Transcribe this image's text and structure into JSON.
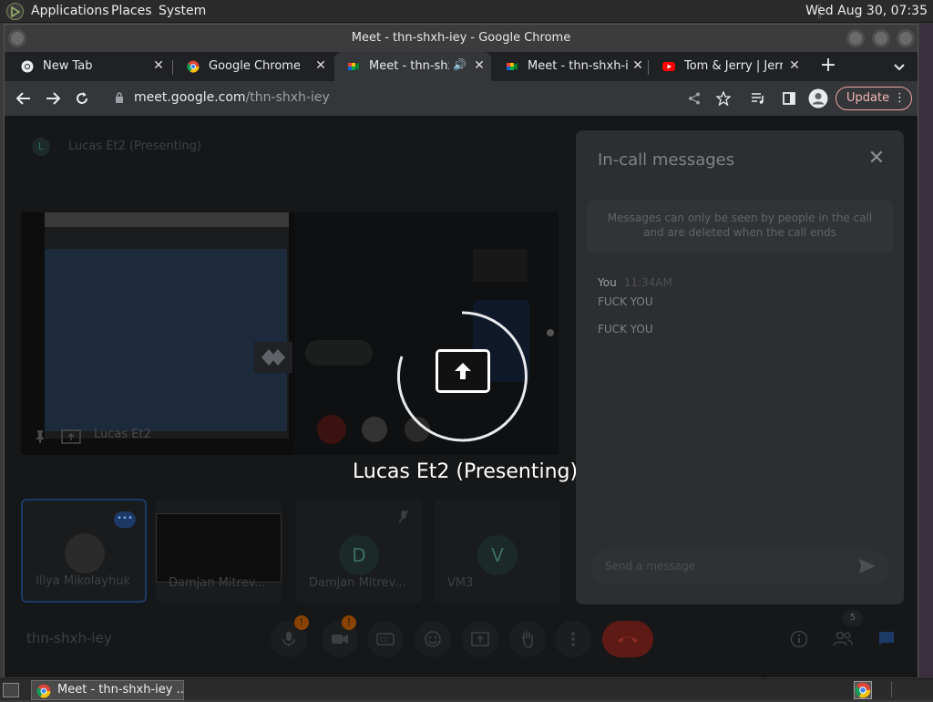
{
  "system_bar": {
    "menus": [
      "Applications",
      "Places",
      "System"
    ],
    "clock": "Wed Aug 30, 07:35"
  },
  "window": {
    "title": "Meet - thn-shxh-iey - Google Chrome"
  },
  "tabs": [
    {
      "label": "New Tab",
      "icon": "chrome-icon",
      "active": false
    },
    {
      "label": "Google Chrome - D",
      "icon": "chrome-icon",
      "active": false
    },
    {
      "label": "Meet - thn-shx",
      "icon": "meet-icon",
      "active": true,
      "audio": true
    },
    {
      "label": "Meet - thn-shxh-ie",
      "icon": "meet-icon",
      "active": false
    },
    {
      "label": "Tom & Jerry | Jerry",
      "icon": "youtube-icon",
      "active": false
    }
  ],
  "toolbar": {
    "url_host": "meet.google.com",
    "url_path": "/thn-shxh-iey",
    "update_label": "Update"
  },
  "meet": {
    "presenter_initial": "L",
    "presenter_heading": "Lucas Et2 (Presenting)",
    "presenting_label": "Lucas Et2 (Presenting)",
    "preview_label": "Lucas Et2",
    "participants": [
      {
        "name": "Illya Mikolayhuk",
        "initial": ""
      },
      {
        "name": "Damjan Mitrev...",
        "initial": ""
      },
      {
        "name": "Damjan Mitrev...",
        "initial": "D"
      },
      {
        "name": "VM3",
        "initial": "V"
      }
    ],
    "meeting_code": "thn-shxh-iey",
    "people_count": "5",
    "badges": [
      "!",
      "!"
    ]
  },
  "chat_panel": {
    "title": "In-call messages",
    "notice": "Messages can only be seen by people in the call and are deleted when the call ends",
    "sender": "You",
    "time": "11:34AM",
    "messages": [
      "FUCK YOU",
      "FUCK YOU"
    ],
    "input_placeholder": "Send a message"
  },
  "taskbar": {
    "window_label": "Meet - thn-shxh-iey ..."
  },
  "colors": {
    "accent": "#8ab4f8",
    "leave": "#ea4335",
    "update_border": "#f2b8b5"
  }
}
